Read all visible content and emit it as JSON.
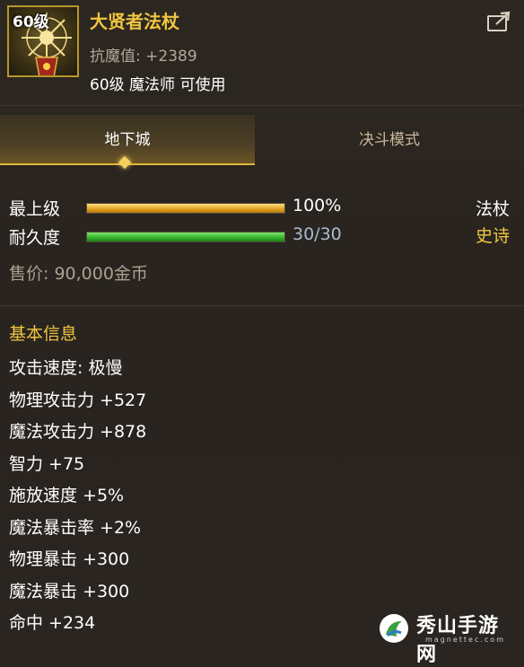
{
  "item": {
    "level_badge": "60级",
    "name": "大贤者法杖",
    "magic_resist": "抗魔值: +2389",
    "requirement": "60级 魔法师 可使用",
    "type": "法杖",
    "rarity": "史诗"
  },
  "tabs": [
    {
      "label": "地下城",
      "active": true
    },
    {
      "label": "决斗模式",
      "active": false
    }
  ],
  "bars": {
    "enhance": {
      "label": "最上级",
      "value": "100%",
      "fraction": 1.0
    },
    "durability": {
      "label": "耐久度",
      "value": "30/30",
      "fraction": 1.0
    }
  },
  "price": "售价: 90,000金币",
  "basic_info": {
    "title": "基本信息",
    "stats": [
      "攻击速度: 极慢",
      "物理攻击力 +527",
      "魔法攻击力 +878",
      "智力 +75",
      "施放速度 +5%",
      "魔法暴击率 +2%",
      "物理暴击 +300",
      "魔法暴击 +300",
      "命中 +234"
    ]
  },
  "watermark": {
    "name": "秀山手游网",
    "site": "magnettec.com"
  },
  "colors": {
    "gold": "#f0c640",
    "accent_bar": "#e0a020",
    "durability_bar": "#33b22a",
    "background": "#2a2520"
  },
  "icons": [
    "staff-item-icon",
    "share-icon",
    "watermark-logo-icon"
  ]
}
